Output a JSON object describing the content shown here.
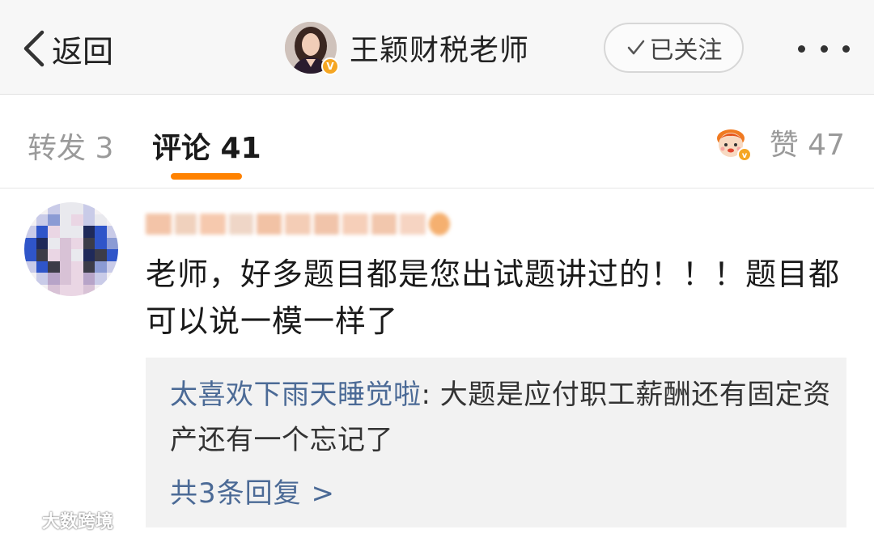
{
  "header": {
    "back_label": "返回",
    "profile_name": "王颖财税老师",
    "verified_badge": "V",
    "follow_label": "已关注",
    "icons": [
      "chevron-left-icon",
      "checkmark-icon",
      "more-dots-icon"
    ]
  },
  "tabs": {
    "repost": "转发 3",
    "comment": "评论 41",
    "like": "赞 47",
    "accent_color": "#ff8200"
  },
  "comment": {
    "text": "老师，好多题目都是您出试题讲过的！！！题目都可以说一模一样了",
    "reply": {
      "author": "太喜欢下雨天睡觉啦",
      "separator": ": ",
      "text": "大题是应付职工薪酬还有固定资产还有一个忘记了",
      "more_label": "共3条回复 >"
    }
  },
  "watermark": {
    "text": "大数跨境"
  },
  "colors": {
    "link": "#4b6a96",
    "muted": "#9a9a9a",
    "verified": "#f5a623"
  }
}
